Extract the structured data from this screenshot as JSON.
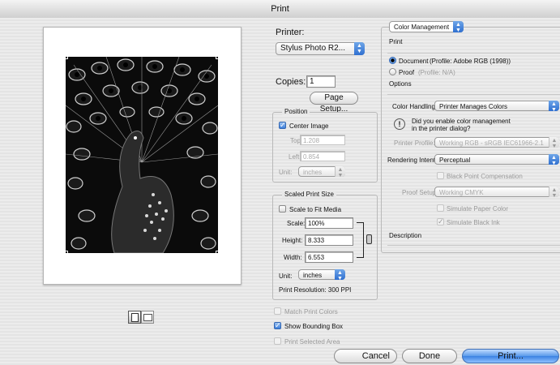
{
  "window": {
    "title": "Print"
  },
  "preview": {
    "image_alt": "Peacock photograph preview"
  },
  "printer": {
    "label": "Printer:",
    "value": "Stylus Photo R2..."
  },
  "copies": {
    "label": "Copies:",
    "value": "1"
  },
  "page_setup": {
    "label": "Page Setup..."
  },
  "position": {
    "title": "Position",
    "center_image": "Center Image",
    "top_label": "Top:",
    "top_value": "1.208",
    "left_label": "Left:",
    "left_value": "0.854",
    "unit_label": "Unit:",
    "unit_value": "inches"
  },
  "scaled": {
    "title": "Scaled Print Size",
    "fit_media": "Scale to Fit Media",
    "scale_label": "Scale:",
    "scale_value": "100%",
    "height_label": "Height:",
    "height_value": "8.333",
    "width_label": "Width:",
    "width_value": "6.553",
    "unit_label": "Unit:",
    "unit_value": "inches",
    "resolution": "Print Resolution: 300 PPI"
  },
  "options": {
    "match_colors": "Match Print Colors",
    "bounding_box": "Show Bounding Box",
    "selected_area": "Print Selected Area"
  },
  "color_panel": {
    "mode": "Color Management",
    "print_heading": "Print",
    "document_label": "Document",
    "document_profile": "(Profile: Adobe RGB (1998))",
    "proof_label": "Proof",
    "proof_profile": "(Profile: N/A)",
    "options_heading": "Options",
    "color_handling_label": "Color Handling:",
    "color_handling_value": "Printer Manages Colors",
    "warning_line1": "Did you enable color management",
    "warning_line2": "in the printer dialog?",
    "printer_profile_label": "Printer Profile:",
    "printer_profile_value": "Working RGB - sRGB IEC61966-2.1",
    "rendering_intent_label": "Rendering Intent:",
    "rendering_intent_value": "Perceptual",
    "black_point": "Black Point Compensation",
    "proof_setup_label": "Proof Setup:",
    "proof_setup_value": "Working CMYK",
    "simulate_paper": "Simulate Paper Color",
    "simulate_ink": "Simulate Black Ink",
    "description_heading": "Description"
  },
  "buttons": {
    "cancel": "Cancel",
    "done": "Done",
    "print": "Print..."
  }
}
